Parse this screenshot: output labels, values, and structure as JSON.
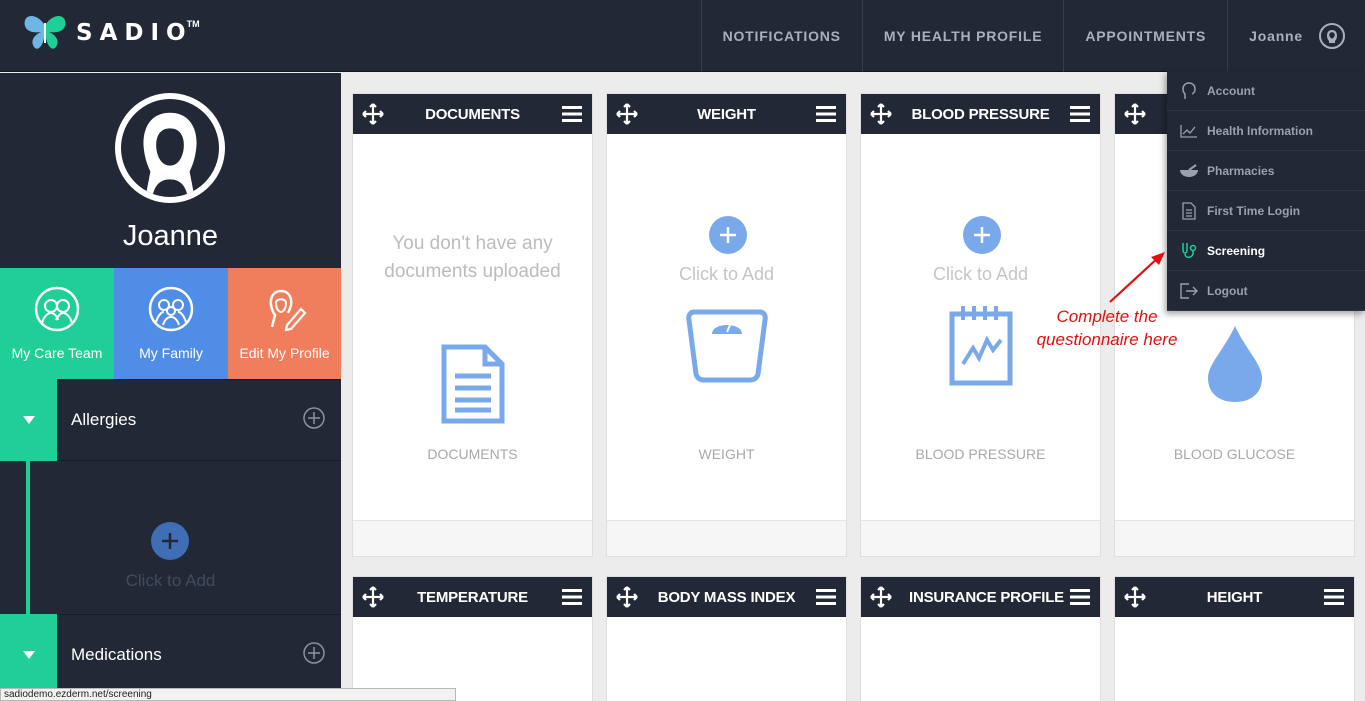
{
  "app": {
    "logo_text": "SADIO",
    "logo_tm": "TM"
  },
  "nav": {
    "notifications": "NOTIFICATIONS",
    "health_profile": "MY HEALTH PROFILE",
    "appointments": "APPOINTMENTS",
    "user_name": "Joanne"
  },
  "profile": {
    "name": "Joanne"
  },
  "tiles": [
    {
      "label": "My Care Team",
      "color": "#1fcf97"
    },
    {
      "label": "My Family",
      "color": "#4f8de6"
    },
    {
      "label": "Edit My Profile",
      "color": "#f07d5c"
    }
  ],
  "sections": {
    "allergies": {
      "title": "Allergies",
      "add_label": "Click to Add"
    },
    "medications": {
      "title": "Medications"
    }
  },
  "cards_row1": [
    {
      "title": "DOCUMENTS",
      "empty_message": "You don't have any documents uploaded",
      "label": "DOCUMENTS",
      "icon": "document-icon"
    },
    {
      "title": "WEIGHT",
      "add_label": "Click to Add",
      "label": "WEIGHT",
      "icon": "scale-icon"
    },
    {
      "title": "BLOOD PRESSURE",
      "add_label": "Click to Add",
      "label": "BLOOD PRESSURE",
      "icon": "clipboard-chart-icon"
    },
    {
      "title": "",
      "label": "BLOOD GLUCOSE",
      "icon": "drop-icon"
    }
  ],
  "cards_row2": [
    {
      "title": "TEMPERATURE"
    },
    {
      "title": "BODY MASS INDEX"
    },
    {
      "title": "INSURANCE PROFILE"
    },
    {
      "title": "HEIGHT"
    }
  ],
  "dropdown": [
    {
      "label": "Account",
      "icon": "head-icon"
    },
    {
      "label": "Health Information",
      "icon": "chart-icon"
    },
    {
      "label": "Pharmacies",
      "icon": "mortar-icon"
    },
    {
      "label": "First Time Login",
      "icon": "document-icon"
    },
    {
      "label": "Screening",
      "icon": "stethoscope-icon",
      "active": true
    },
    {
      "label": "Logout",
      "icon": "logout-icon"
    }
  ],
  "annotation": {
    "line1": "Complete the",
    "line2": "questionnaire here",
    "color": "#e01010"
  },
  "status_url": "sadiodemo.ezderm.net/screening",
  "colors": {
    "dark": "#222835",
    "accent_green": "#1fcf97",
    "accent_blue": "#4f8de6",
    "accent_orange": "#f07d5c",
    "icon_blue": "#7aa9eb"
  }
}
